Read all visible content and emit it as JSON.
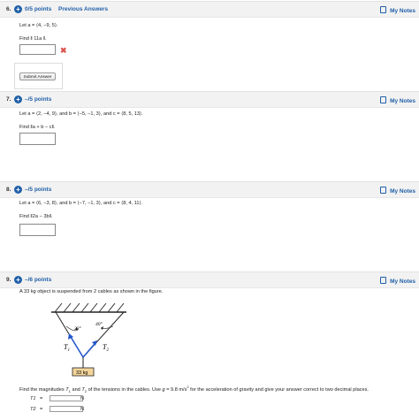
{
  "q6": {
    "number": "6.",
    "points": "0/5 points",
    "previous": "Previous Answers",
    "notes": "My Notes",
    "line1": "Let a = ⟨4, −9, 5⟩.",
    "line2": "Find ‖ 11a ‖.",
    "submit": "Submit Answer",
    "wrong_mark": "✖"
  },
  "q7": {
    "number": "7.",
    "points": "–/5 points",
    "notes": "My Notes",
    "line1": "Let a = ⟨2, −4, 9⟩, and b = ⟨−5, −1, 3⟩, and c = ⟨8, 5, 13⟩.",
    "line2": "Find ‖a + b − c‖."
  },
  "q8": {
    "number": "8.",
    "points": "–/5 points",
    "notes": "My Notes",
    "line1": "Let a = ⟨6, −3, 8⟩, and b = ⟨−7, −1, 3⟩, and c = ⟨8, 4, 11⟩.",
    "line2": "Find ‖2a − 3b‖."
  },
  "q9": {
    "number": "9.",
    "points": "–/6 points",
    "notes": "My Notes",
    "line1": "A 33 kg object is suspended from 2 cables as shown in the figure.",
    "angle_left": "33°",
    "angle_right": "40°",
    "t1_label": "T1",
    "t2_label": "T2",
    "mass_label": "33 kg",
    "line2": "Find the magnitudes T1 and T2 of the tensions in the cables. Use g = 9.8 m/s² for the acceleration of gravity and give your answer correct to two decimal places.",
    "t1_row_label": "T1",
    "t2_row_label": "T2",
    "eq": "=",
    "unit": "N"
  }
}
